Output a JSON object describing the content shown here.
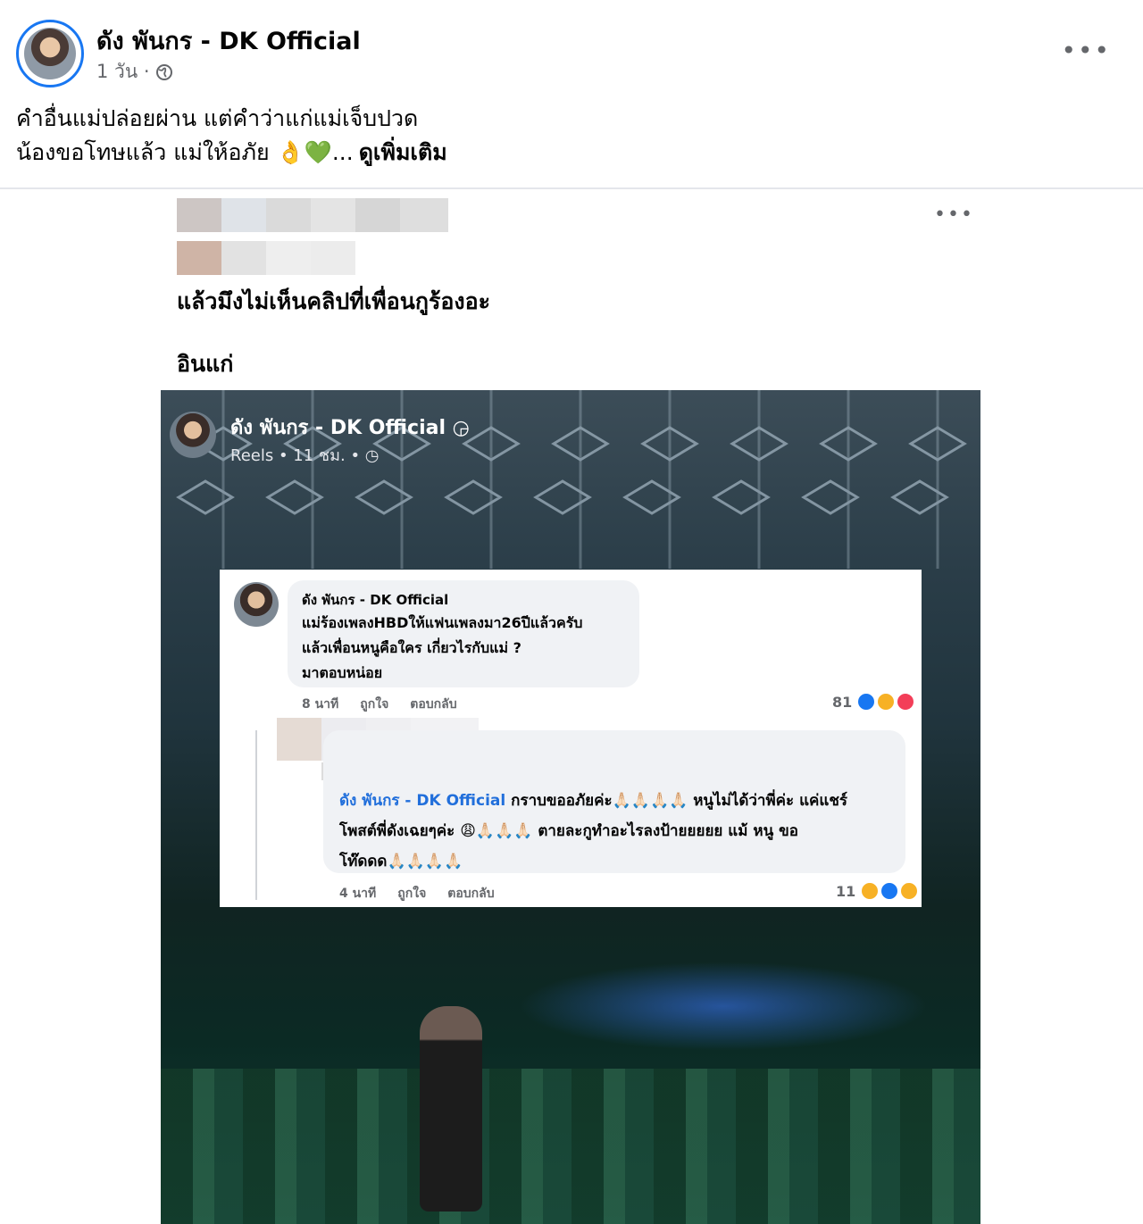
{
  "post": {
    "author": "ดัง พันกร - DK Official",
    "time": "1 วัน ·",
    "privacy_icon": "globe-icon",
    "more_icon": "•••",
    "caption_line1": "คำอื่นแม่ปล่อยผ่าน แต่คำว่าแก่แม่เจ็บปวด",
    "caption_line2": "น้องขอโทษแล้ว แม่ให้อภัย 👌💚...",
    "see_more": "ดูเพิ่มเติม"
  },
  "embedded": {
    "more_icon": "•••",
    "text_line1": "แล้วมึงไม่เห็นคลิปที่เพื่อนกูร้องอะ",
    "text_line2": "อินแก่"
  },
  "video": {
    "author": "ดัง พันกร - DK Official",
    "meta": "Reels • 11 ชม. • ",
    "comment1": {
      "name": "ดัง พันกร - DK Official",
      "line1": "แม่ร้องเพลงHBDให้แฟนเพลงมา26ปีแล้วครับ",
      "line2": "แล้วเพื่อนหนูคือใคร เกี่ยวไรกับแม่ ?",
      "line3": "มาตอบหน่อย",
      "time": "8 นาที",
      "like": "ถูกใจ",
      "reply": "ตอบกลับ",
      "reaction_count": "81"
    },
    "comment2": {
      "mention": "ดัง พันกร - DK Official",
      "line1": " กราบขออภัยค่ะ🙏🏻🙏🏻🙏🏻🙏🏻 หนูไม่ได้ว่าพี่ค่ะ  แค่แชร์",
      "line2": "โพสต์พี่ดังเฉยๆค่ะ 😩🙏🏻🙏🏻🙏🏻  ตายละกูทำอะไรลงป้ายยยยย แม้ หนู ขอ",
      "line3": "โท๊ดดด🙏🏻🙏🏻🙏🏻🙏🏻",
      "time": "4 นาที",
      "like": "ถูกใจ",
      "reply": "ตอบกลับ",
      "reaction_count": "11"
    }
  },
  "colors": {
    "accent": "#1877f2",
    "mention": "#216fdb",
    "secondary_text": "#65676b",
    "divider": "#e4e6eb"
  }
}
